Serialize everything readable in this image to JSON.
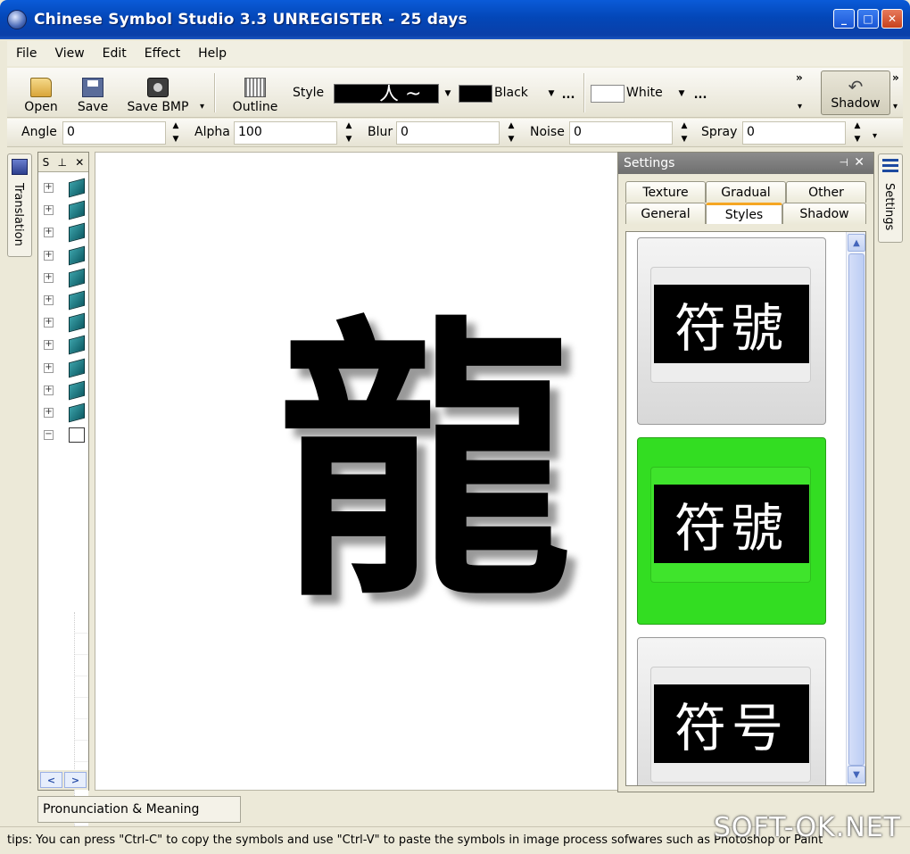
{
  "window": {
    "title": "Chinese Symbol Studio 3.3 UNREGISTER - 25 days"
  },
  "menu": [
    "File",
    "View",
    "Edit",
    "Effect",
    "Help"
  ],
  "toolbar": {
    "open": "Open",
    "save": "Save",
    "save_bmp": "Save BMP",
    "outline": "Outline",
    "style_label": "Style",
    "fg_color": "Black",
    "bg_color": "White",
    "ellipsis": "...",
    "shadow": "Shadow",
    "chevron": "»"
  },
  "effects": {
    "angle": {
      "label": "Angle",
      "value": "0"
    },
    "alpha": {
      "label": "Alpha",
      "value": "100"
    },
    "blur": {
      "label": "Blur",
      "value": "0"
    },
    "noise": {
      "label": "Noise",
      "value": "0"
    },
    "spray": {
      "label": "Spray",
      "value": "0"
    }
  },
  "left_tab": "Translation",
  "tree": {
    "header": "S"
  },
  "canvas": {
    "symbol": "龍"
  },
  "settings": {
    "title": "Settings",
    "tabs_top": [
      "Texture",
      "Gradual",
      "Other"
    ],
    "tabs_bottom": [
      "General",
      "Styles",
      "Shadow"
    ],
    "active_tab": "Styles",
    "thumbs": [
      "符號",
      "符號",
      "符号"
    ]
  },
  "right_tab": "Settings",
  "bottom_tab": "Pronunciation & Meaning",
  "status": "tips: You can press \"Ctrl-C\" to copy the symbols and use \"Ctrl-V\" to paste the symbols in image process sofwares such as Photoshop or Paint",
  "watermark": "SOFT-OK.NET",
  "colors": {
    "fg": "#000000",
    "bg": "#ffffff",
    "selected_style": "#33dd22"
  }
}
